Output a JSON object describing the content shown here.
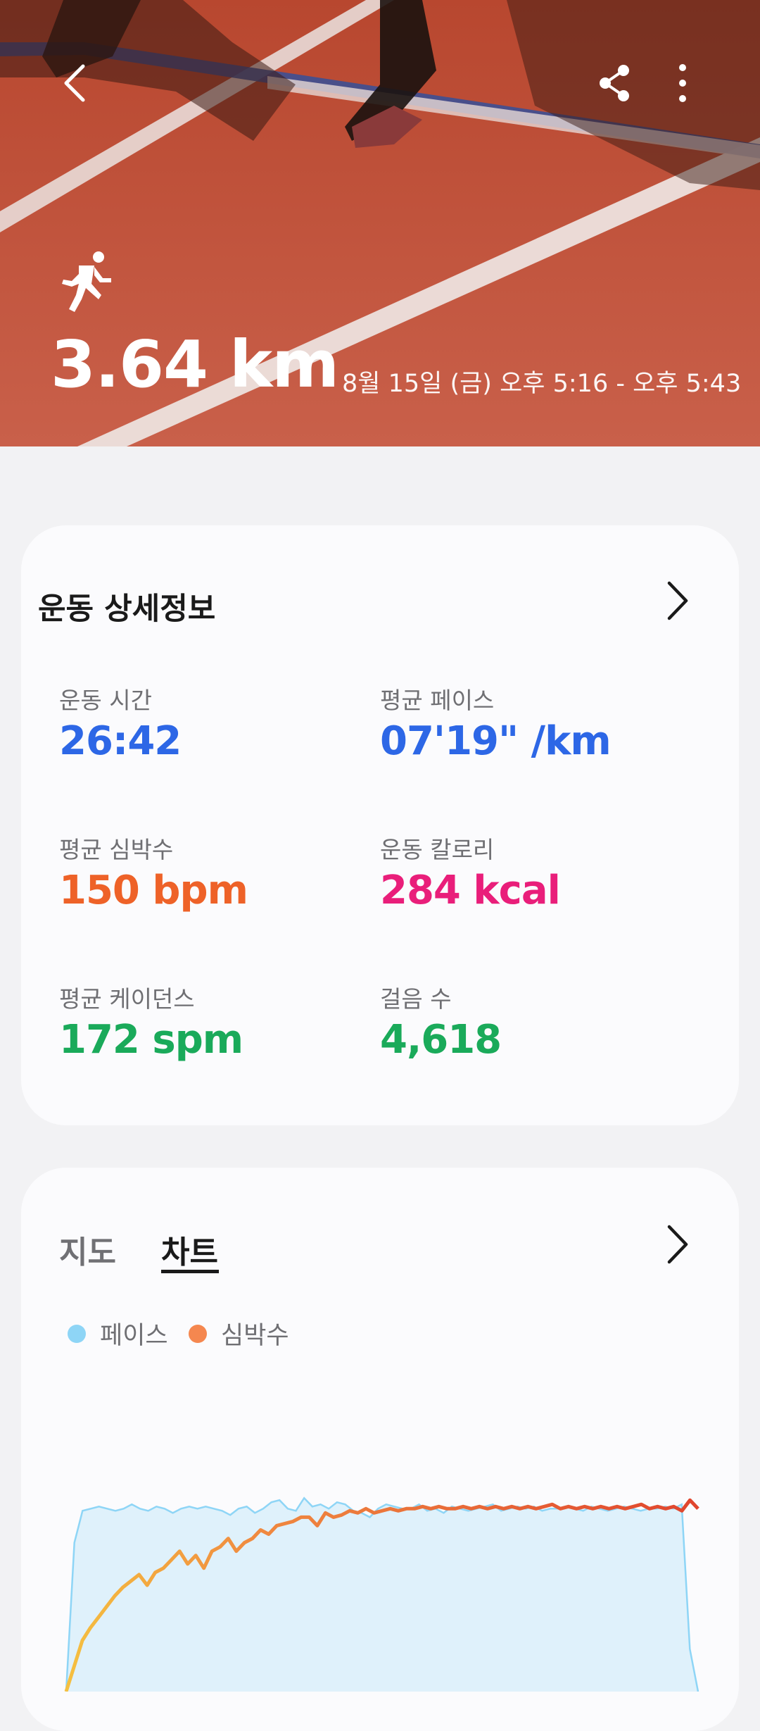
{
  "hero": {
    "distance": "3.64 km",
    "date_range": "8월 15일 (금) 오후 5:16 - 오후 5:43"
  },
  "icons": {
    "back": "chevron-left-icon",
    "share": "share-icon",
    "more": "more-vertical-icon",
    "activity": "running-icon",
    "details_more": "chevron-right-icon",
    "chart_more": "chevron-right-icon"
  },
  "details": {
    "title": "운동 상세정보",
    "metrics": [
      {
        "label": "운동 시간",
        "value": "26:42",
        "color": "#2d67e6"
      },
      {
        "label": "평균 페이스",
        "value": "07'19\" /km",
        "color": "#2d67e6"
      },
      {
        "label": "평균 심박수",
        "value": "150 bpm",
        "color": "#ee6228"
      },
      {
        "label": "운동 칼로리",
        "value": "284 kcal",
        "color": "#e91e7a"
      },
      {
        "label": "평균 케이던스",
        "value": "172 spm",
        "color": "#1aaa5a"
      },
      {
        "label": "걸음 수",
        "value": "4,618",
        "color": "#1aaa5a"
      }
    ]
  },
  "chart_card": {
    "tabs": [
      {
        "label": "지도",
        "active": false
      },
      {
        "label": "차트",
        "active": true
      }
    ],
    "legend": [
      {
        "label": "페이스",
        "color": "#8ed5f6"
      },
      {
        "label": "심박수",
        "color": "#f5874f"
      }
    ]
  },
  "chart_data": {
    "type": "area",
    "series": [
      {
        "name": "페이스",
        "color": "#8ed5f6",
        "values": [
          0,
          70,
          85,
          86,
          87,
          86,
          85,
          86,
          88,
          86,
          85,
          87,
          86,
          84,
          86,
          87,
          86,
          87,
          86,
          85,
          83,
          86,
          87,
          84,
          86,
          89,
          90,
          86,
          85,
          91,
          87,
          88,
          86,
          89,
          88,
          85,
          84,
          82,
          86,
          88,
          87,
          86,
          86,
          88,
          85,
          86,
          84,
          87,
          86,
          85,
          86,
          87,
          88,
          85,
          86,
          87,
          86,
          87,
          85,
          86,
          86,
          87,
          86,
          85,
          87,
          86,
          85,
          86,
          87,
          86,
          85,
          86,
          86,
          87,
          86,
          88,
          20,
          0
        ]
      },
      {
        "name": "심박수",
        "color": "#f5874f",
        "values": [
          0,
          12,
          24,
          30,
          35,
          40,
          45,
          49,
          52,
          55,
          50,
          56,
          58,
          62,
          66,
          60,
          64,
          58,
          66,
          68,
          72,
          66,
          70,
          72,
          76,
          74,
          78,
          79,
          80,
          82,
          82,
          78,
          84,
          82,
          83,
          85,
          84,
          86,
          84,
          85,
          86,
          85,
          86,
          86,
          87,
          86,
          87,
          86,
          86,
          87,
          86,
          87,
          86,
          87,
          86,
          87,
          86,
          87,
          86,
          87,
          88,
          86,
          87,
          86,
          87,
          86,
          87,
          86,
          87,
          86,
          87,
          88,
          86,
          87,
          86,
          87,
          85,
          90,
          86
        ]
      }
    ]
  }
}
